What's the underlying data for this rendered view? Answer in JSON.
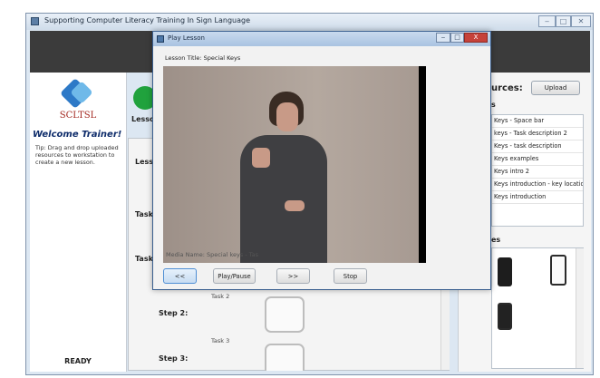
{
  "window": {
    "title": "Supporting Computer Literacy Training In Sign Language",
    "min": "‒",
    "max": "□",
    "close": "✕"
  },
  "sidebar": {
    "logo_text": "SCLTSL",
    "welcome": "Welcome Trainer!",
    "tip": "Tip: Drag and drop uploaded resources to workstation to create a new lesson.",
    "status": "READY"
  },
  "main": {
    "lesson_label": "Lesson",
    "lesson2_label": "Lesso",
    "task_label_1": "Task",
    "task_label_2": "Task",
    "step2": "Step 2:",
    "step3": "Step 3:",
    "task2": "Task 2",
    "task3": "Task 3"
  },
  "resources": {
    "title": "urces:",
    "upload_label": "Upload",
    "lessons_section": "s",
    "lessons": [
      "Keys - Space bar",
      "keys - Task description 2",
      "Keys - task description",
      "Keys examples",
      "Keys intro 2",
      "Keys introduction - key location",
      "Keys introduction"
    ],
    "devices_section": "es"
  },
  "dialog": {
    "title": "Play Lesson",
    "lesson_title": "Lesson Title: Special Keys",
    "media_name": "Media Name: Special keys - Tas",
    "btn_prev": "<<",
    "btn_play": "Play/Pause",
    "btn_next": ">>",
    "btn_stop": "Stop",
    "min": "‒",
    "max": "□",
    "close": "X"
  },
  "colors": {
    "accent": "#4e8ed4",
    "brand": "#a3271f",
    "welcome": "#0f2d6b",
    "dark_bar": "#3b3b3b"
  }
}
